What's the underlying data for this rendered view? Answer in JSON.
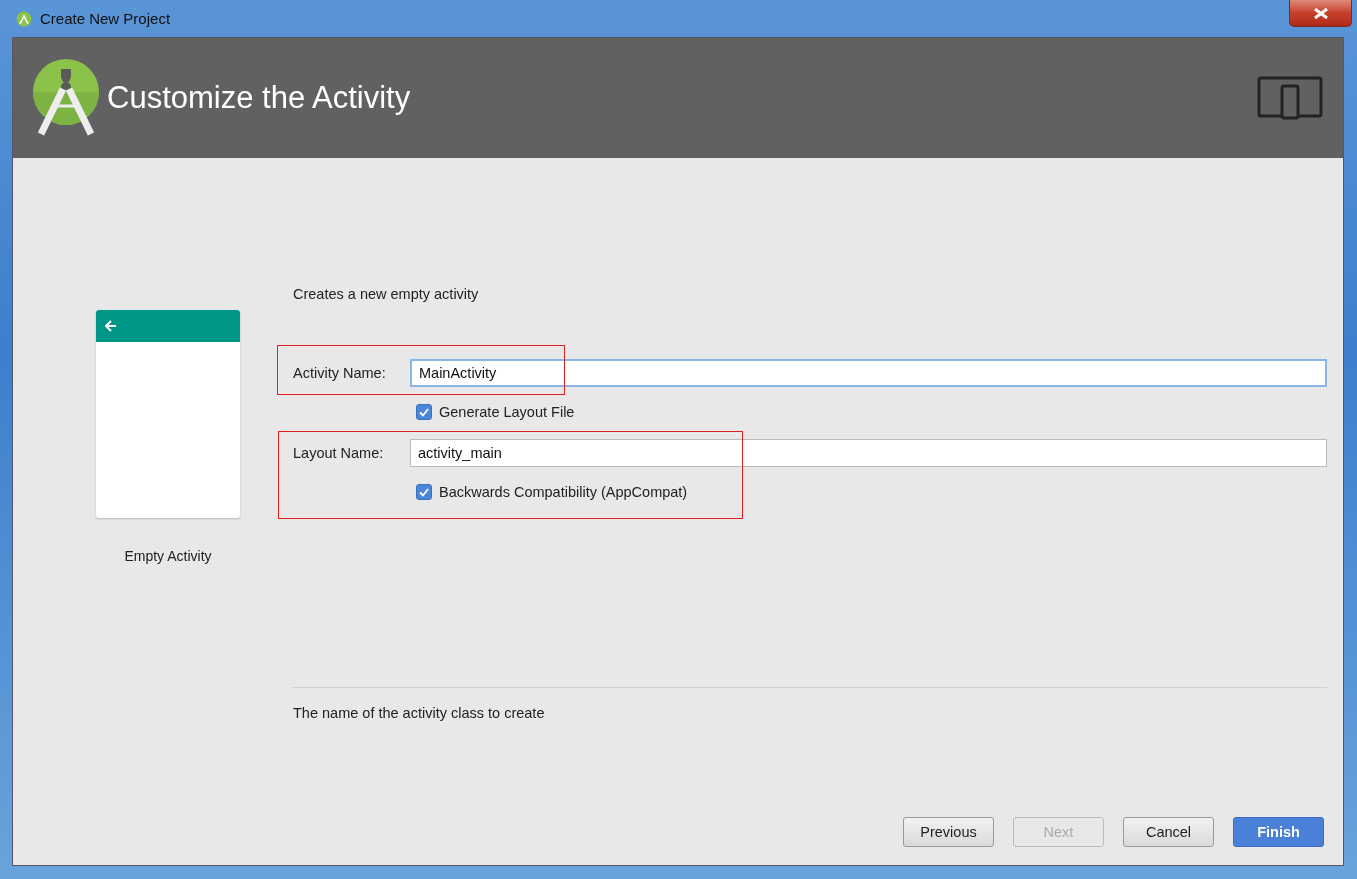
{
  "window": {
    "title": "Create New Project"
  },
  "header": {
    "title": "Customize the Activity"
  },
  "template": {
    "name": "Empty Activity"
  },
  "description": "Creates a new empty activity",
  "fields": [
    {
      "label": "Activity Name:",
      "value": "MainActivity",
      "focused": true,
      "highlighted": true,
      "checkbox": {
        "label": "Generate Layout File",
        "checked": true,
        "highlighted": false
      }
    },
    {
      "label": "Layout Name:",
      "value": "activity_main",
      "focused": false,
      "highlighted": true,
      "checkbox": {
        "label": "Backwards Compatibility (AppCompat)",
        "checked": true,
        "highlighted": true
      }
    }
  ],
  "help_text": "The name of the activity class to create",
  "buttons": [
    {
      "label": "Previous",
      "disabled": false,
      "primary": false
    },
    {
      "label": "Next",
      "disabled": true,
      "primary": false
    },
    {
      "label": "Cancel",
      "disabled": false,
      "primary": false
    },
    {
      "label": "Finish",
      "disabled": false,
      "primary": true
    }
  ]
}
